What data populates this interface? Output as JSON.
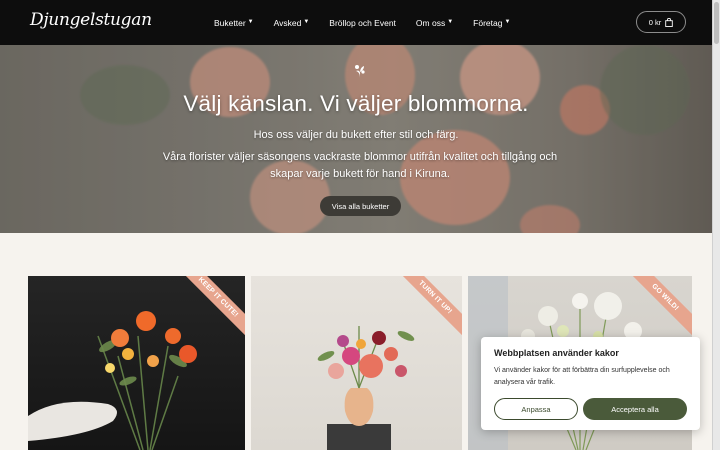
{
  "header": {
    "logo": "Djungelstugan",
    "nav": [
      {
        "label": "Buketter",
        "has_dropdown": true
      },
      {
        "label": "Avsked",
        "has_dropdown": true
      },
      {
        "label": "Bröllop och Event",
        "has_dropdown": false
      },
      {
        "label": "Om oss",
        "has_dropdown": true
      },
      {
        "label": "Företag",
        "has_dropdown": true
      }
    ],
    "cart_label": "0 kr",
    "cart_icon": "shopping-bag-icon"
  },
  "hero": {
    "icon": "flower-icon",
    "title": "Välj känslan. Vi väljer blommorna.",
    "subtitle": "Hos oss väljer du bukett efter stil och färg.",
    "description": "Våra florister väljer säsongens vackraste blommor utifrån kvalitet och tillgång och skapar varje bukett för hand i Kiruna.",
    "button": "Visa alla buketter"
  },
  "products": [
    {
      "ribbon": "KEEP IT CUTE!"
    },
    {
      "ribbon": "TURN IT UP!"
    },
    {
      "ribbon": "GO WILD!"
    }
  ],
  "cookie": {
    "title": "Webbplatsen använder kakor",
    "text": "Vi använder kakor för att förbättra din surfupplevelse och analysera vår trafik.",
    "customize": "Anpassa",
    "accept": "Acceptera alla"
  },
  "colors": {
    "header_bg": "#0d0d0d",
    "ribbon": "#e7a58e",
    "accept_button": "#4a5a3a",
    "hero_button": "#3d3b36"
  }
}
